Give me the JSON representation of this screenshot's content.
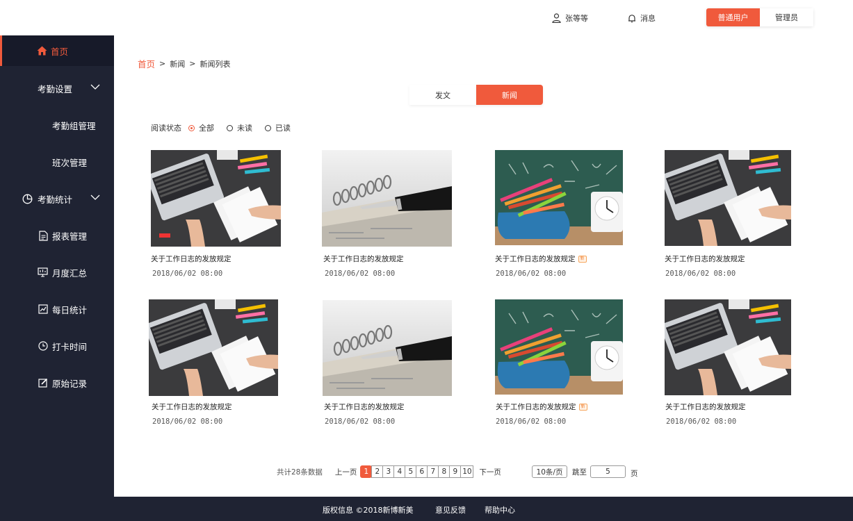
{
  "header": {
    "user_name": "张等等",
    "messages_label": "消息",
    "roles": [
      {
        "label": "普通用户",
        "active": true
      },
      {
        "label": "管理员",
        "active": false
      }
    ]
  },
  "sidebar": {
    "items": [
      {
        "label": "首页",
        "icon": "home-icon",
        "active": true
      },
      {
        "label": "考勤设置",
        "icon": "",
        "expandable": true
      },
      {
        "label": "考勤组管理",
        "icon": ""
      },
      {
        "label": "班次管理",
        "icon": ""
      },
      {
        "label": "考勤统计",
        "icon": "pie-chart-icon",
        "expandable": true
      },
      {
        "label": "报表管理",
        "icon": "report-icon"
      },
      {
        "label": "月度汇总",
        "icon": "monitor-icon"
      },
      {
        "label": "每日统计",
        "icon": "line-chart-icon"
      },
      {
        "label": "打卡时间",
        "icon": "clock-icon"
      },
      {
        "label": "原始记录",
        "icon": "edit-icon"
      }
    ]
  },
  "breadcrumb": {
    "home": "首页",
    "level2": "新闻",
    "level3": "新闻列表",
    "separator": ">"
  },
  "tabs": [
    {
      "label": "发文",
      "active": false
    },
    {
      "label": "新闻",
      "active": true
    }
  ],
  "filter": {
    "label": "阅读状态",
    "options": [
      {
        "label": "全部",
        "checked": true
      },
      {
        "label": "未读",
        "checked": false
      },
      {
        "label": "已读",
        "checked": false
      }
    ]
  },
  "news": [
    {
      "title": "关于工作日志的发放规定",
      "date": "2018/06/02  08:00",
      "image": "laptop-desk-photo",
      "is_new": false
    },
    {
      "title": "关于工作日志的发放规定",
      "date": "2018/06/02  08:00",
      "image": "pen-notebook-photo",
      "is_new": false
    },
    {
      "title": "关于工作日志的发放规定",
      "date": "2018/06/02  08:00",
      "image": "pencils-clock-photo",
      "is_new": true
    },
    {
      "title": "关于工作日志的发放规定",
      "date": "2018/06/02  08:00",
      "image": "laptop-desk-photo",
      "is_new": false
    },
    {
      "title": "关于工作日志的发放规定",
      "date": "2018/06/02  08:00",
      "image": "laptop-desk-photo",
      "is_new": false
    },
    {
      "title": "关于工作日志的发放规定",
      "date": "2018/06/02  08:00",
      "image": "pen-notebook-photo",
      "is_new": false
    },
    {
      "title": "关于工作日志的发放规定",
      "date": "2018/06/02  08:00",
      "image": "pencils-clock-photo",
      "is_new": true
    },
    {
      "title": "关于工作日志的发放规定",
      "date": "2018/06/02  08:00",
      "image": "laptop-desk-photo",
      "is_new": false
    }
  ],
  "new_badge": "新",
  "pagination": {
    "total": "共计28条数据",
    "prev": "上一页",
    "next": "下一页",
    "pages": [
      "1",
      "2",
      "3",
      "4",
      "5",
      "6",
      "7",
      "8",
      "9",
      "10"
    ],
    "current": "1",
    "per_page": "10条/页",
    "jump_label": "跳至",
    "jump_value": "5",
    "page_word": "页"
  },
  "footer": {
    "copyright": "版权信息 ©2018新博新美",
    "feedback": "意见反馈",
    "help": "帮助中心"
  },
  "colors": {
    "accent": "#f05a3c",
    "sidebar_bg": "#1f2333",
    "footer_bg": "#1f2333"
  }
}
